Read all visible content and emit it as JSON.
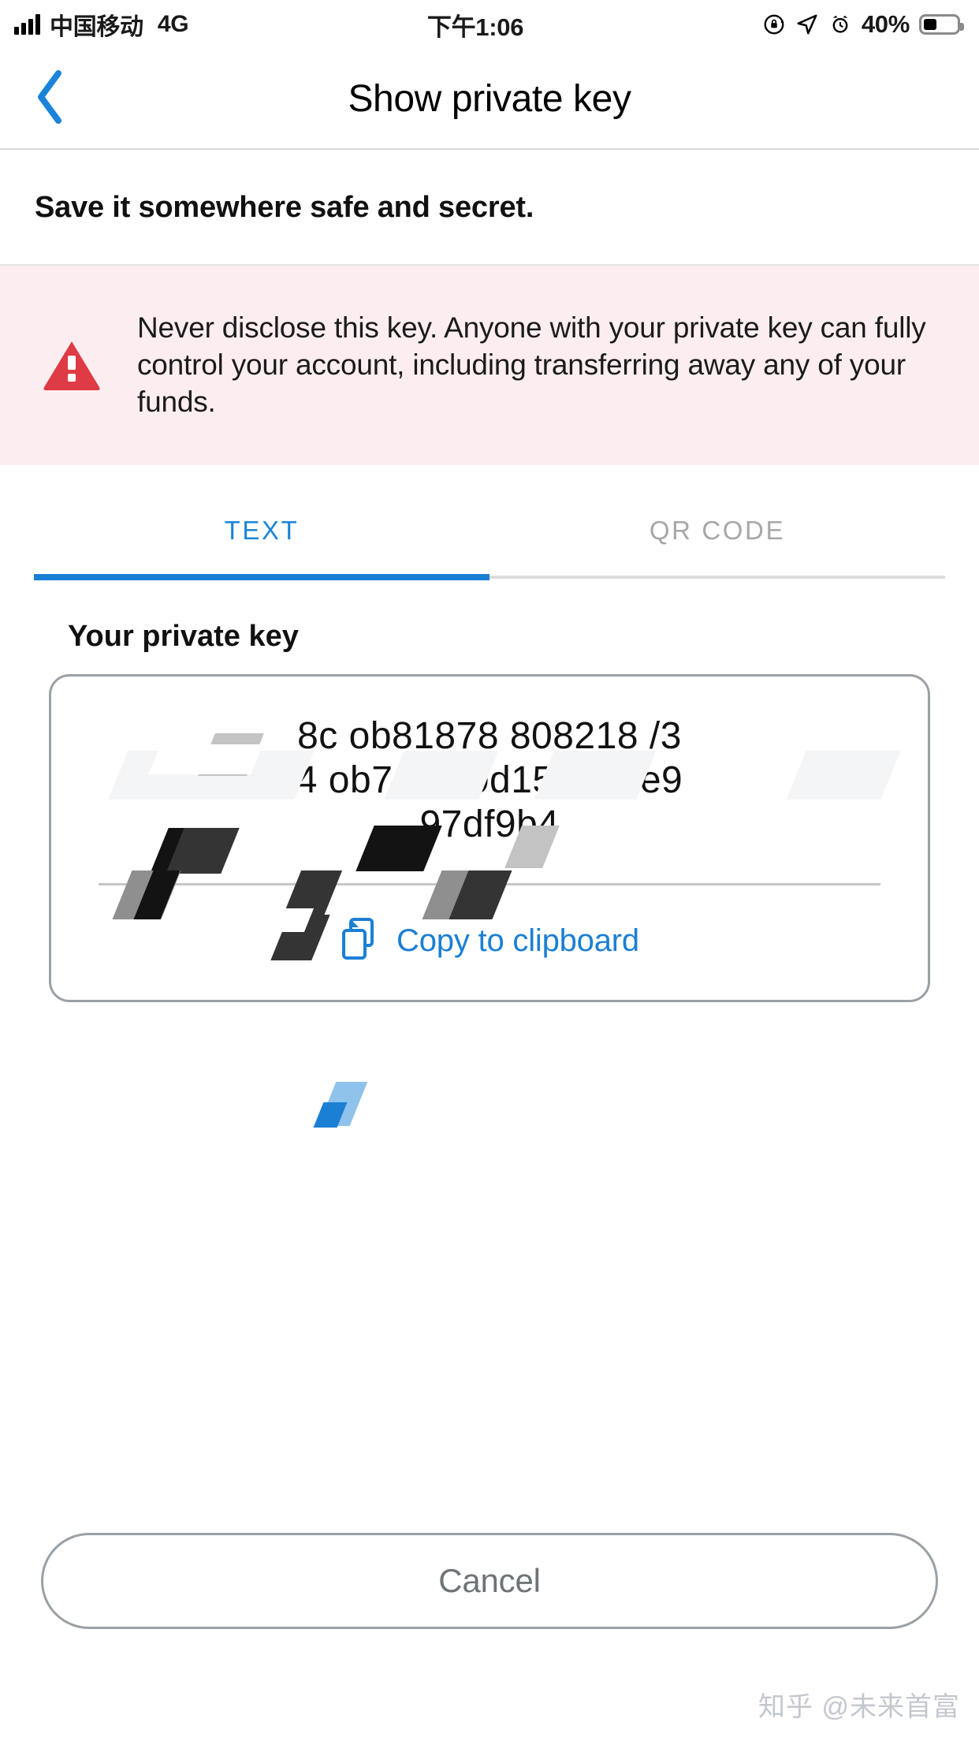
{
  "status_bar": {
    "carrier": "中国移动",
    "network": "4G",
    "time": "下午1:06",
    "battery_percent": "40%",
    "icons": [
      "signal-bars-icon",
      "rotation-lock-icon",
      "location-arrow-icon",
      "alarm-clock-icon",
      "battery-icon"
    ]
  },
  "nav": {
    "back_icon": "chevron-left-icon",
    "title": "Show private key"
  },
  "subtitle": "Save it somewhere safe and secret.",
  "warning": {
    "icon": "warning-triangle-icon",
    "text": "Never disclose this key. Anyone with your private key can fully control your account, including transferring away any of your funds.",
    "background": "#fceef0",
    "icon_color": "#df3b45"
  },
  "tabs": {
    "items": [
      {
        "label": "TEXT",
        "active": true
      },
      {
        "label": "QR CODE",
        "active": false
      }
    ],
    "active_color": "#1b7fd4",
    "inactive_color": "#a7a7a7"
  },
  "key_section": {
    "label": "Your private key",
    "key_lines": [
      "8c    ob81878   808218   /3",
      "4  ob7e23   0d156b   /7e9",
      "97df9b4"
    ],
    "copy": {
      "icon": "copy-icon",
      "label": "Copy to clipboard",
      "color": "#1b7fd4"
    }
  },
  "cancel": {
    "label": "Cancel",
    "color": "#6d7478"
  },
  "watermark": "知乎 @未来首富"
}
